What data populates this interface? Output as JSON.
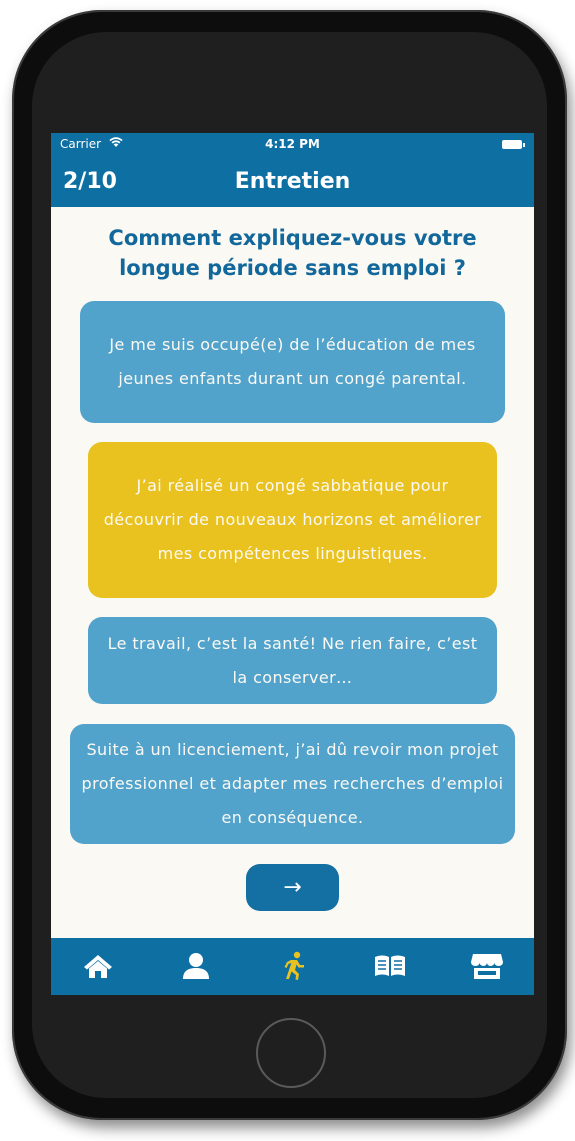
{
  "status_bar": {
    "carrier": "Carrier",
    "time": "4:12 PM"
  },
  "nav": {
    "counter": "2/10",
    "title": "Entretien"
  },
  "question": "Comment expliquez-vous votre longue période sans emploi ?",
  "answers": [
    {
      "text": "Je me suis occupé(e) de l’éducation de mes jeunes enfants durant un congé parental.",
      "state": "default"
    },
    {
      "text": "J’ai réalisé un congé sabbatique pour découvrir de nouveaux horizons et améliorer mes compétences linguistiques.",
      "state": "selected"
    },
    {
      "text": "Le travail, c’est la santé! Ne rien faire, c’est la conserver…",
      "state": "default"
    },
    {
      "text": "Suite à un licenciement, j’ai dû revoir mon projet professionnel et adapter mes recherches d’emploi en conséquence.",
      "state": "default"
    }
  ],
  "next_button": {
    "icon": "arrow-right-icon",
    "glyph": "→"
  },
  "tabs": [
    {
      "icon": "home-icon",
      "active": false
    },
    {
      "icon": "user-icon",
      "active": false
    },
    {
      "icon": "running-person-icon",
      "active": true
    },
    {
      "icon": "open-book-icon",
      "active": false
    },
    {
      "icon": "store-icon",
      "active": false
    }
  ],
  "colors": {
    "primary": "#0e6fa3",
    "answer_default": "#52a3cc",
    "answer_selected": "#e9c220",
    "tab_active": "#e9c220",
    "background": "#fbf9f4"
  }
}
